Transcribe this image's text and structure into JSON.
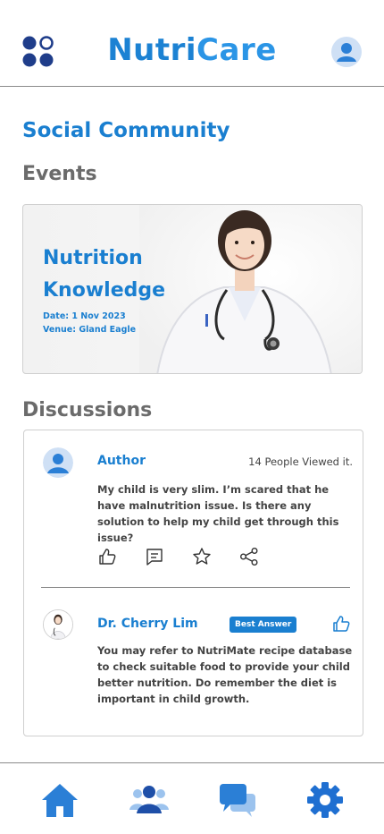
{
  "header": {
    "brand_part1": "Nutri",
    "brand_part2": "Care",
    "menu_icon": "grid-menu-icon",
    "profile_icon": "user-profile-icon"
  },
  "page": {
    "section_title": "Social Community",
    "events_title": "Events",
    "discussions_title": "Discussions"
  },
  "event": {
    "title": "Nutrition Knowledge",
    "date": "Date: 1 Nov 2023",
    "venue": "Venue: Gland Eagle",
    "image": "doctor-photo"
  },
  "discussion": {
    "author": "Author",
    "views": "14 People Viewed it.",
    "post": "My child is very slim. I’m scared that he have malnutrition issue. Is there any solution to help my child get through this issue?",
    "actions": [
      "like-icon",
      "comment-icon",
      "star-icon",
      "share-icon"
    ],
    "answer": {
      "name": "Dr. Cherry Lim",
      "badge": "Best Answer",
      "text": "You may refer to NutriMate recipe database to check suitable food to provide your child better nutrition. Do remember the diet is important in child growth."
    }
  },
  "nav": {
    "items": [
      "home-icon",
      "community-icon",
      "chat-icon",
      "settings-icon"
    ]
  },
  "colors": {
    "brand": "#1c82d3",
    "accent": "#2b95e6",
    "heading_gray": "#6b6b6b",
    "border": "#cfcfcf"
  }
}
